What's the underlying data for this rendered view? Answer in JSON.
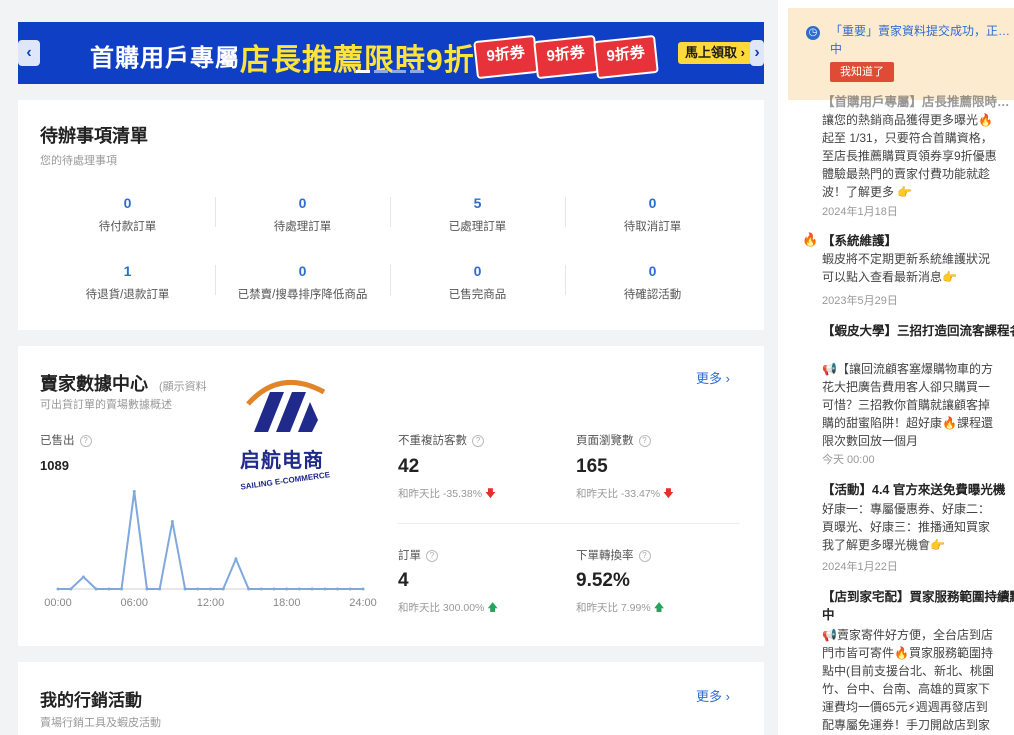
{
  "banner": {
    "prev": "‹",
    "next": "›",
    "title1": "首購用戶專屬",
    "title2": "店長推薦限時9折",
    "coupons": [
      "9折券",
      "9折券",
      "9折券"
    ],
    "cta": "馬上領取 ›"
  },
  "todo": {
    "title": "待辦事項清單",
    "subtitle": "您的待處理事項",
    "items": [
      {
        "value": "0",
        "label": "待付款訂單"
      },
      {
        "value": "0",
        "label": "待處理訂單"
      },
      {
        "value": "5",
        "label": "已處理訂單"
      },
      {
        "value": "0",
        "label": "待取消訂單"
      },
      {
        "value": "1",
        "label": "待退貨/退款訂單"
      },
      {
        "value": "0",
        "label": "已禁賣/搜尋排序降低商品"
      },
      {
        "value": "0",
        "label": "已售完商品"
      },
      {
        "value": "0",
        "label": "待確認活動"
      }
    ]
  },
  "datacenter": {
    "title": "賣家數據中心",
    "title_note": "(顯示資料",
    "subtitle": "可出貨訂單的賣場數據概述",
    "more": "更多 ›",
    "sold_label": "已售出",
    "sold_value": "1089",
    "metrics": [
      {
        "label": "不重複訪客數",
        "value": "42",
        "cmp": "和昨天比 -35.38%",
        "dir": "down"
      },
      {
        "label": "頁面瀏覽數",
        "value": "165",
        "cmp": "和昨天比 -33.47%",
        "dir": "down"
      },
      {
        "label": "訂單",
        "value": "4",
        "cmp": "和昨天比 300.00%",
        "dir": "up"
      },
      {
        "label": "下單轉換率",
        "value": "9.52%",
        "cmp": "和昨天比 7.99%",
        "dir": "up"
      }
    ]
  },
  "chart_data": {
    "type": "line",
    "x": [
      0,
      1,
      2,
      3,
      4,
      5,
      6,
      7,
      8,
      9,
      10,
      11,
      12,
      13,
      14,
      15,
      16,
      17,
      18,
      19,
      20,
      21,
      22,
      23,
      24
    ],
    "values": [
      0,
      0,
      8,
      0,
      0,
      0,
      65,
      0,
      0,
      45,
      0,
      0,
      0,
      0,
      20,
      0,
      0,
      0,
      0,
      0,
      0,
      0,
      0,
      0,
      0
    ],
    "xticks": [
      "00:00",
      "06:00",
      "12:00",
      "18:00",
      "24:00"
    ],
    "ylim": [
      0,
      70
    ],
    "grid": false,
    "color": "#7fa8dd"
  },
  "watermark": {
    "cn": "启航电商",
    "en": "SAILING E-COMMERCE"
  },
  "marketing": {
    "title": "我的行銷活動",
    "subtitle": "賣場行銷工具及蝦皮活動",
    "more": "更多 ›"
  },
  "notice": {
    "text": "「重要」賣家資料提交成功，正…中",
    "button": "我知道了"
  },
  "news": [
    {
      "title": "【首購用戶專屬】店長推薦限時…",
      "body": "讓您的熱銷商品獲得更多曝光🔥\n起至 1/31，只要符合首購資格，\n至店長推薦購買頁領券享9折優惠\n體驗最熱門的賣家付費功能就趁\n波！了解更多 👉",
      "date": "2024年1月18日"
    },
    {
      "title": "【系統維護】",
      "body": "蝦皮將不定期更新系統維護狀況\n可以點入查看最新消息👉",
      "date": "2023年5月29日"
    },
    {
      "title": "【蝦皮大學】三招打造回流客課程名",
      "body": "📢【讓回流顧客塞爆購物車的方\n花大把廣告費用客人卻只購買一\n可惜？三招教你首購就讓顧客掉\n購的甜蜜陷阱！超好康🔥課程還\n限次數回放一個月",
      "date": "今天 00:00"
    },
    {
      "title": "【活動】4.4 官方來送免費曝光機",
      "body": "好康一：專屬優惠券、好康二：\n頁曝光、好康三：推播通知買家\n我了解更多曝光機會👉",
      "date": "2024年1月22日"
    },
    {
      "title": "【店到家宅配】買家服務範圍持續點中",
      "body": "📢賣家寄件好方便，全台店到店\n門市皆可寄件🔥買家服務範圍持\n點中(目前支援台北、新北、桃園\n竹、台中、台南、高雄的買家下\n運費均一價65元⚡週週再發店到\n配專屬免運券！手刀開啟店到家",
      "date": ""
    }
  ]
}
